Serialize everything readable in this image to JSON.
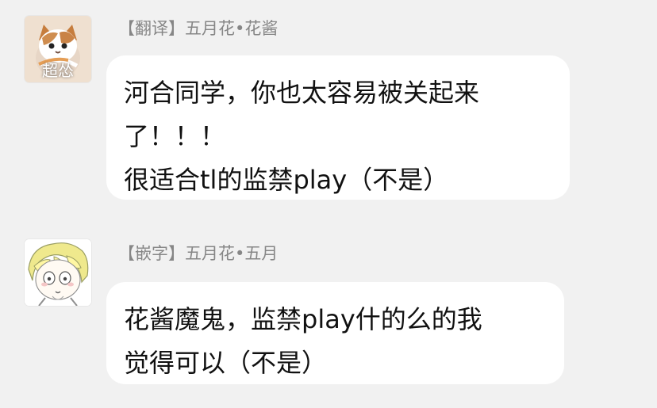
{
  "messages": [
    {
      "sender": "【翻译】五月花•花酱",
      "avatar": {
        "icon": "cat-avatar-icon",
        "caption": "超怂"
      },
      "lines": [
        "河合同学，你也太容易被关起来",
        "了！！！",
        "很适合tl的监禁play（不是）"
      ]
    },
    {
      "sender": "【嵌字】五月花•五月",
      "avatar": {
        "icon": "anime-avatar-icon"
      },
      "lines": [
        "花酱魔鬼，监禁play什的么的我",
        "觉得可以（不是）"
      ]
    }
  ],
  "colors": {
    "page_background": "#f1f1f1",
    "bubble_background": "#ffffff",
    "sender_text": "#868686",
    "message_text": "#111111"
  }
}
